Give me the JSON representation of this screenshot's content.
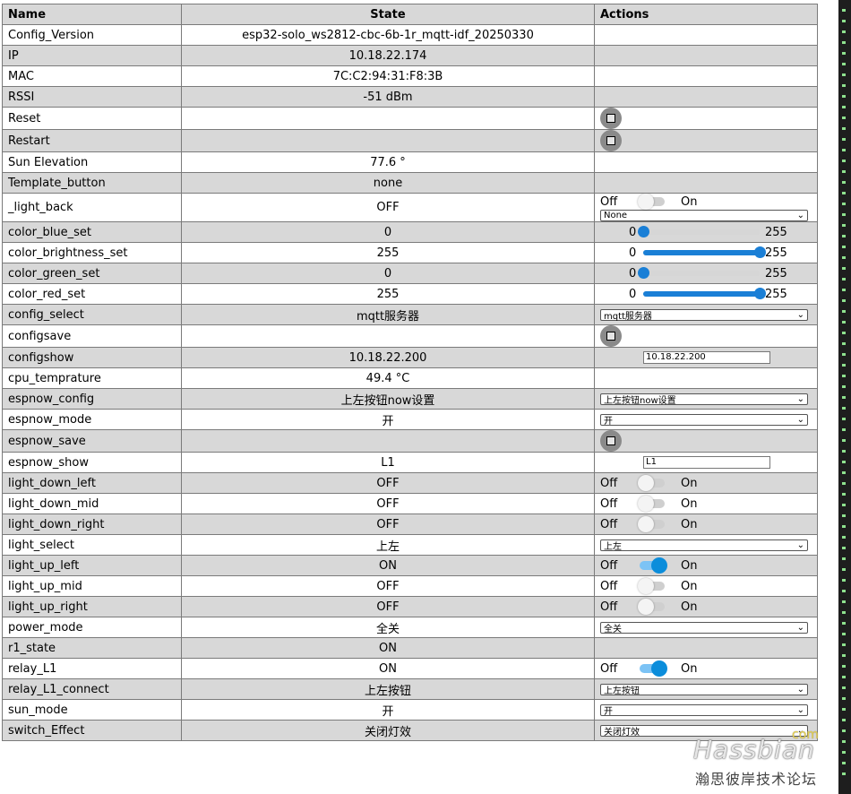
{
  "headers": {
    "name": "Name",
    "state": "State",
    "actions": "Actions"
  },
  "rows": [
    {
      "name": "Config_Version",
      "state": "esp32-solo_ws2812-cbc-6b-1r_mqtt-idf_20250330",
      "action": "none"
    },
    {
      "name": "IP",
      "state": "10.18.22.174",
      "action": "none"
    },
    {
      "name": "MAC",
      "state": "7C:C2:94:31:F8:3B",
      "action": "none"
    },
    {
      "name": "RSSI",
      "state": "-51 dBm",
      "action": "none"
    },
    {
      "name": "Reset",
      "state": "",
      "action": "button"
    },
    {
      "name": "Restart",
      "state": "",
      "action": "button"
    },
    {
      "name": "Sun Elevation",
      "state": "77.6 °",
      "action": "none"
    },
    {
      "name": "Template_button",
      "state": "none",
      "action": "none"
    },
    {
      "name": "_light_back",
      "state": "OFF",
      "action": "switch_select",
      "on": false,
      "select": "None"
    },
    {
      "name": "color_blue_set",
      "state": "0",
      "action": "slider",
      "min": "0",
      "max": "255",
      "value": 0
    },
    {
      "name": "color_brightness_set",
      "state": "255",
      "action": "slider",
      "min": "0",
      "max": "255",
      "value": 255
    },
    {
      "name": "color_green_set",
      "state": "0",
      "action": "slider",
      "min": "0",
      "max": "255",
      "value": 0
    },
    {
      "name": "color_red_set",
      "state": "255",
      "action": "slider",
      "min": "0",
      "max": "255",
      "value": 255
    },
    {
      "name": "config_select",
      "state": "mqtt服务器",
      "action": "select",
      "select": "mqtt服务器"
    },
    {
      "name": "configsave",
      "state": "",
      "action": "button"
    },
    {
      "name": "configshow",
      "state": "10.18.22.200",
      "action": "text",
      "text": "10.18.22.200"
    },
    {
      "name": "cpu_temprature",
      "state": "49.4 °C",
      "action": "none"
    },
    {
      "name": "espnow_config",
      "state": "上左按钮now设置",
      "action": "select",
      "select": "上左按钮now设置"
    },
    {
      "name": "espnow_mode",
      "state": "开",
      "action": "select",
      "select": "开"
    },
    {
      "name": "espnow_save",
      "state": "",
      "action": "button"
    },
    {
      "name": "espnow_show",
      "state": "L1",
      "action": "text",
      "text": "L1"
    },
    {
      "name": "light_down_left",
      "state": "OFF",
      "action": "switch",
      "on": false
    },
    {
      "name": "light_down_mid",
      "state": "OFF",
      "action": "switch",
      "on": false
    },
    {
      "name": "light_down_right",
      "state": "OFF",
      "action": "switch",
      "on": false
    },
    {
      "name": "light_select",
      "state": "上左",
      "action": "select",
      "select": "上左"
    },
    {
      "name": "light_up_left",
      "state": "ON",
      "action": "switch",
      "on": true
    },
    {
      "name": "light_up_mid",
      "state": "OFF",
      "action": "switch",
      "on": false
    },
    {
      "name": "light_up_right",
      "state": "OFF",
      "action": "switch",
      "on": false
    },
    {
      "name": "power_mode",
      "state": "全关",
      "action": "select",
      "select": "全关"
    },
    {
      "name": "r1_state",
      "state": "ON",
      "action": "none"
    },
    {
      "name": "relay_L1",
      "state": "ON",
      "action": "switch",
      "on": true
    },
    {
      "name": "relay_L1_connect",
      "state": "上左按钮",
      "action": "select",
      "select": "上左按钮"
    },
    {
      "name": "sun_mode",
      "state": "开",
      "action": "select",
      "select": "开"
    },
    {
      "name": "switch_Effect",
      "state": "关闭灯效",
      "action": "select",
      "select": "关闭灯效"
    }
  ],
  "switch_labels": {
    "off": "Off",
    "on": "On"
  },
  "watermark": {
    "brand": "Hassbian",
    "domain": "com",
    "subtitle": "瀚思彼岸技术论坛"
  },
  "colors": {
    "header_bg": "#d8d8d8",
    "stripe_bg": "#d8d8d8",
    "accent": "#1a7fd6",
    "switch_on": "#0b8ddb"
  }
}
